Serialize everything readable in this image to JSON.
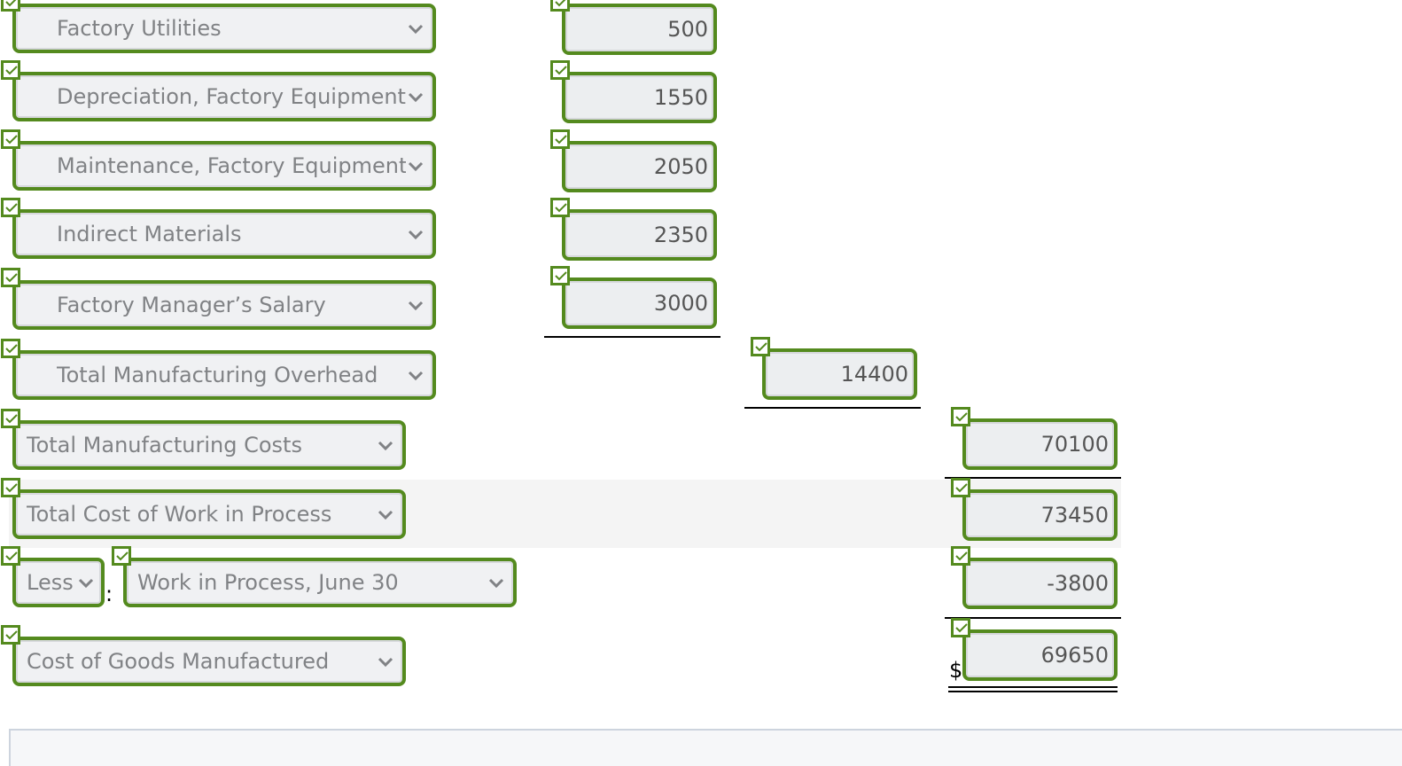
{
  "rows": [
    {
      "label": "Factory Utilities",
      "amount": "500"
    },
    {
      "label": "Depreciation, Factory Equipment",
      "amount": "1550"
    },
    {
      "label": "Maintenance, Factory Equipment",
      "amount": "2050"
    },
    {
      "label": "Indirect Materials",
      "amount": "2350"
    },
    {
      "label": "Factory Manager’s Salary",
      "amount": "3000"
    },
    {
      "label": "Total Manufacturing Overhead",
      "amount": "14400"
    },
    {
      "label": "Total Manufacturing Costs",
      "amount": "70100"
    },
    {
      "label": "Total Cost of Work in Process",
      "amount": "73450"
    },
    {
      "modifier": "Less",
      "separator": ":",
      "label": "Work in Process, June 30",
      "amount": "-3800"
    },
    {
      "label": "Cost of Goods Manufactured",
      "currency": "$",
      "amount": "69650"
    }
  ],
  "status": {
    "all_correct": true,
    "check_icon": "checkmark-icon"
  },
  "colors": {
    "correct_border": "#548a1e",
    "field_bg": "#f0f1f3",
    "row_highlight": "#f4f4f4"
  }
}
